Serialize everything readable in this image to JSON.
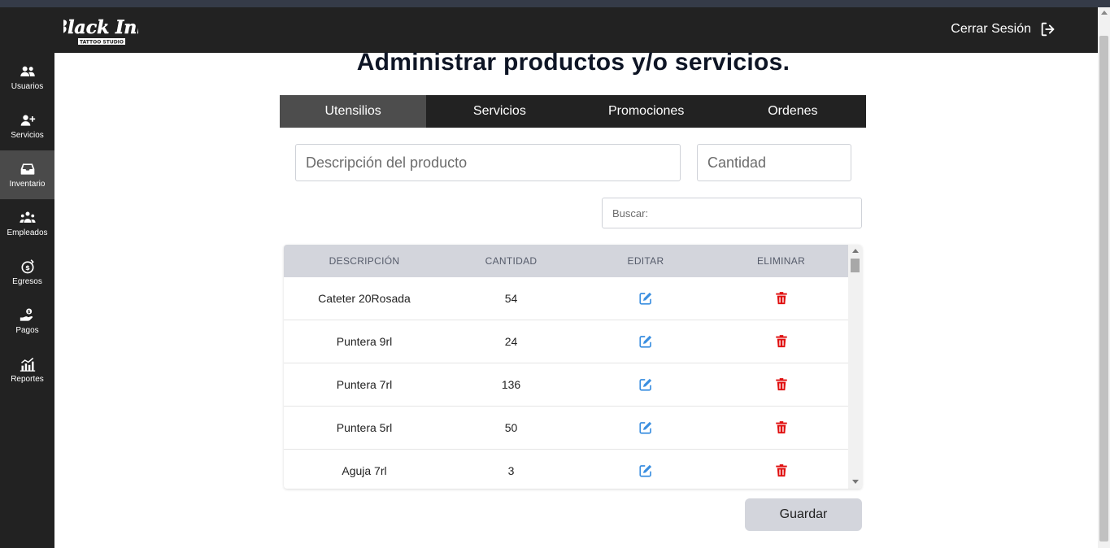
{
  "app": {
    "logo_text": "Black Ink",
    "logo_subtext": "TATTOO STUDIO"
  },
  "header": {
    "logout_label": "Cerrar Sesión",
    "logout_icon": "logout-icon"
  },
  "sidebar": {
    "items": [
      {
        "label": "Usuarios",
        "icon": "users-icon",
        "active": false
      },
      {
        "label": "Servicios",
        "icon": "user-plus-icon",
        "active": false
      },
      {
        "label": "Inventario",
        "icon": "inbox-icon",
        "active": true
      },
      {
        "label": "Empleados",
        "icon": "group-icon",
        "active": false
      },
      {
        "label": "Egresos",
        "icon": "money-icon",
        "active": false
      },
      {
        "label": "Pagos",
        "icon": "hand-coin-icon",
        "active": false
      },
      {
        "label": "Reportes",
        "icon": "chart-icon",
        "active": false
      }
    ]
  },
  "main": {
    "title": "Administrar productos y/o servicios.",
    "tabs": [
      {
        "label": "Utensilios",
        "active": true
      },
      {
        "label": "Servicios",
        "active": false
      },
      {
        "label": "Promociones",
        "active": false
      },
      {
        "label": "Ordenes",
        "active": false
      }
    ],
    "form": {
      "description_placeholder": "Descripción del producto",
      "description_value": "",
      "quantity_placeholder": "Cantidad",
      "quantity_value": ""
    },
    "search": {
      "placeholder": "Buscar:",
      "value": ""
    },
    "table": {
      "headers": [
        "DESCRIPCIÓN",
        "CANTIDAD",
        "EDITAR",
        "ELIMINAR"
      ],
      "rows": [
        {
          "description": "Cateter 20Rosada",
          "quantity": "54"
        },
        {
          "description": "Puntera 9rl",
          "quantity": "24"
        },
        {
          "description": "Puntera 7rl",
          "quantity": "136"
        },
        {
          "description": "Puntera 5rl",
          "quantity": "50"
        },
        {
          "description": "Aguja 7rl",
          "quantity": "3"
        }
      ]
    },
    "save_label": "Guardar"
  },
  "colors": {
    "dark": "#222222",
    "active_tab": "#4d4d4d",
    "edit_icon": "#3b8fe0",
    "delete_icon": "#e01010",
    "header_row": "#d3d5dc"
  }
}
